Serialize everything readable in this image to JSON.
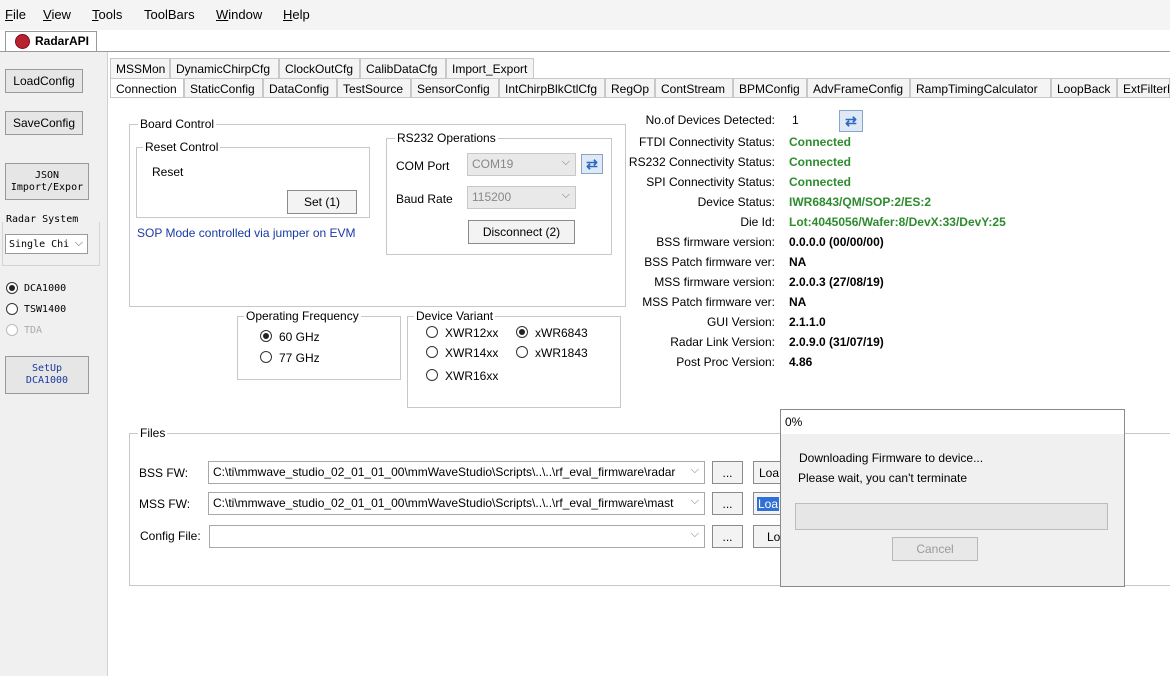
{
  "menu": {
    "file": {
      "accel": "F",
      "rest": "ile"
    },
    "view": {
      "accel": "V",
      "rest": "iew"
    },
    "tools": {
      "accel": "T",
      "rest": "ools"
    },
    "toolbars": "ToolBars",
    "window": {
      "accel": "W",
      "rest": "indow"
    },
    "help": {
      "accel": "H",
      "rest": "elp"
    }
  },
  "app_tab": "RadarAPI",
  "left_panel": {
    "load_config": "LoadConfig",
    "save_config": "SaveConfig",
    "json_button": "JSON\nImport/Expor",
    "radar_system_label": "Radar System",
    "radar_system_value": "Single Chi",
    "capture_options": [
      "DCA1000",
      "TSW1400",
      "TDA"
    ],
    "setup_button": "SetUp\nDCA1000"
  },
  "tabs_row1": [
    "MSSMon",
    "DynamicChirpCfg",
    "ClockOutCfg",
    "CalibDataCfg",
    "Import_Export"
  ],
  "tabs_row2": [
    "Connection",
    "StaticConfig",
    "DataConfig",
    "TestSource",
    "SensorConfig",
    "IntChirpBlkCtlCfg",
    "RegOp",
    "ContStream",
    "BPMConfig",
    "AdvFrameConfig",
    "RampTimingCalculator",
    "LoopBack",
    "ExtFilterP"
  ],
  "board_control": {
    "title": "Board Control",
    "reset_control_title": "Reset Control",
    "reset_label": "Reset",
    "set_button": "Set (1)",
    "sop_note": "SOP Mode controlled via jumper on EVM"
  },
  "rs232": {
    "title": "RS232 Operations",
    "com_port_label": "COM Port",
    "com_port_value": "COM19",
    "baud_rate_label": "Baud Rate",
    "baud_rate_value": "115200",
    "disconnect_button": "Disconnect (2)"
  },
  "operating_frequency": {
    "title": "Operating Frequency",
    "options": [
      "60 GHz",
      "77 GHz"
    ],
    "selected": "60 GHz"
  },
  "device_variant": {
    "title": "Device Variant",
    "options": [
      "XWR12xx",
      "xWR6843",
      "XWR14xx",
      "xWR1843",
      "XWR16xx"
    ],
    "selected": "xWR6843"
  },
  "status": [
    {
      "label": "No.of Devices Detected:",
      "value": "1",
      "style": "plain"
    },
    {
      "label": "FTDI Connectivity Status:",
      "value": "Connected",
      "style": "green"
    },
    {
      "label": "RS232 Connectivity Status:",
      "value": "Connected",
      "style": "green"
    },
    {
      "label": "SPI Connectivity Status:",
      "value": "Connected",
      "style": "green"
    },
    {
      "label": "Device Status:",
      "value": "IWR6843/QM/SOP:2/ES:2",
      "style": "green"
    },
    {
      "label": "Die Id:",
      "value": "Lot:4045056/Wafer:8/DevX:33/DevY:25",
      "style": "green"
    },
    {
      "label": "BSS firmware version:",
      "value": "0.0.0.0 (00/00/00)",
      "style": "bold"
    },
    {
      "label": "BSS Patch firmware ver:",
      "value": "NA",
      "style": "bold"
    },
    {
      "label": "MSS firmware version:",
      "value": "2.0.0.3 (27/08/19)",
      "style": "bold"
    },
    {
      "label": "MSS Patch firmware ver:",
      "value": "NA",
      "style": "bold"
    },
    {
      "label": "GUI Version:",
      "value": "2.1.1.0",
      "style": "bold"
    },
    {
      "label": "Radar Link Version:",
      "value": "2.0.9.0 (31/07/19)",
      "style": "bold"
    },
    {
      "label": "Post Proc Version:",
      "value": "4.86",
      "style": "bold"
    }
  ],
  "files": {
    "title": "Files",
    "bss_label": "BSS FW:",
    "bss_value": "C:\\ti\\mmwave_studio_02_01_01_00\\mmWaveStudio\\Scripts\\..\\..\\rf_eval_firmware\\radar",
    "mss_label": "MSS FW:",
    "mss_value": "C:\\ti\\mmwave_studio_02_01_01_00\\mmWaveStudio\\Scripts\\..\\..\\rf_eval_firmware\\mast",
    "config_label": "Config File:",
    "config_value": "",
    "browse": "...",
    "load_bss": "Loa",
    "load_mss": "Loa",
    "load_cfg": "Lo"
  },
  "progress_dialog": {
    "title": "0%",
    "line1": "Downloading Firmware to device...",
    "line2": "Please wait, you can't terminate",
    "progress": 0,
    "cancel_button": "Cancel"
  }
}
